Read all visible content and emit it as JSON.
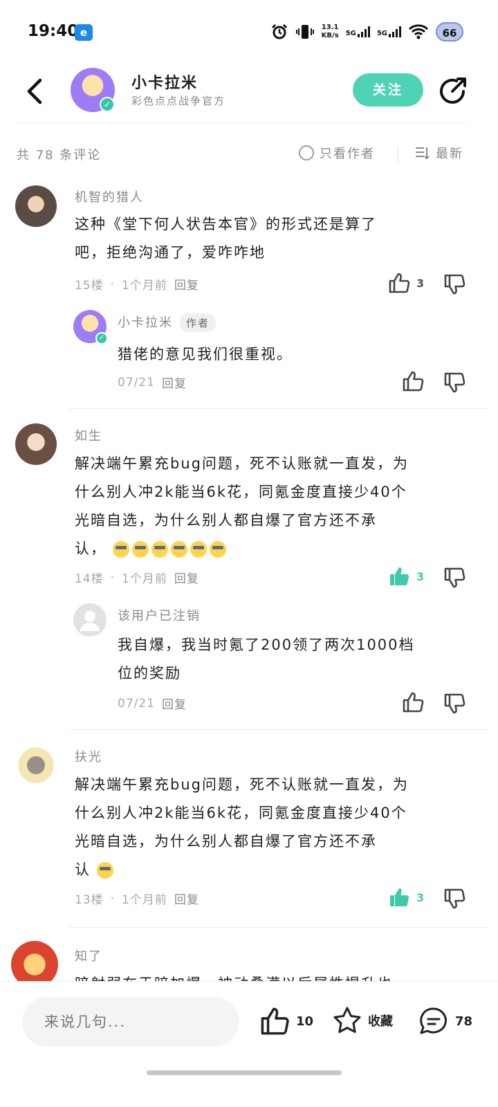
{
  "status_bar": {
    "time": "19:40",
    "app_icon_letter": "e",
    "speed_value": "13.1",
    "speed_unit": "KB/s",
    "net1": "5G",
    "net2": "5G",
    "battery": "66",
    "icons": [
      "alarm-icon",
      "vibrate-icon",
      "signal-icon",
      "wifi-icon",
      "battery-icon"
    ]
  },
  "header": {
    "author_name": "小卡拉米",
    "author_subtitle": "彩色点点战争官方",
    "follow_label": "关注"
  },
  "sort_bar": {
    "comment_count": "共 78 条评论",
    "author_only": "只看作者",
    "sort_latest": "最新"
  },
  "comments": [
    {
      "user": "机智的猎人",
      "text_line1": "这种《堂下何人状告本官》的形式还是算了",
      "text_line2": "吧，拒绝沟通了，爱咋咋地",
      "floor": "15楼",
      "time": "1个月前",
      "reply": "回复",
      "likes": "3",
      "reply_item": {
        "user": "小卡拉米",
        "tag": "作者",
        "text": "猎佬的意见我们很重视。",
        "date": "07/21",
        "reply": "回复"
      }
    },
    {
      "user": "如生",
      "text_line1": "解决端午累充bug问题，死不认账就一直发，为",
      "text_line2": "什么别人冲2k能当6k花，同氪金度直接少40个",
      "text_line3": "光暗自选，为什么别人都自爆了官方还不承",
      "text_line4": "认，",
      "floor": "14楼",
      "time": "1个月前",
      "reply": "回复",
      "likes": "3",
      "reply_item": {
        "user": "该用户已注销",
        "text_line1": "我自爆，我当时氪了200领了两次1000档",
        "text_line2": "位的奖励",
        "date": "07/21",
        "reply": "回复"
      }
    },
    {
      "user": "扶光",
      "text_line1": "解决端午累充bug问题，死不认账就一直发，为",
      "text_line2": "什么别人冲2k能当6k花，同氪金度直接少40个",
      "text_line3": "光暗自选，为什么别人都自爆了官方还不承",
      "text_line4": "认",
      "floor": "13楼",
      "time": "1个月前",
      "reply": "回复",
      "likes": "3"
    },
    {
      "user": "知了",
      "text_partial": "暗射弱在于暗加爆，被动叠满以后属性提升也"
    }
  ],
  "bottom_bar": {
    "input_placeholder": "来说几句...",
    "like_count": "10",
    "favorite_label": "收藏",
    "comment_count": "78"
  },
  "colors": {
    "accent": "#4fd3b6",
    "active_like": "#3fcbab",
    "muted_text": "#8a8a8a"
  }
}
